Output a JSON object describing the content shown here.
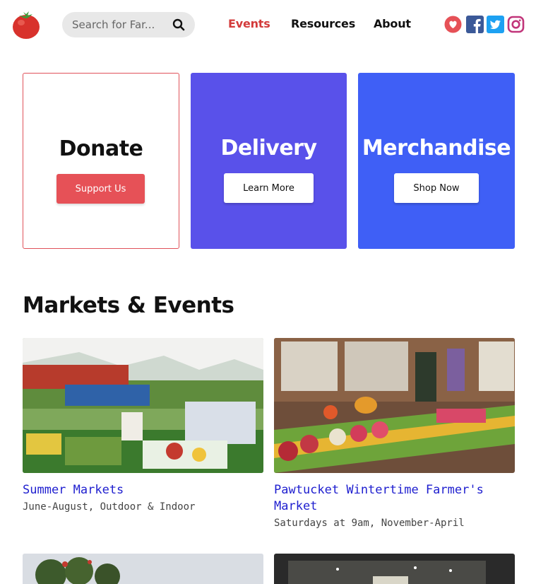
{
  "header": {
    "logo": "tomato-logo-icon",
    "search": {
      "placeholder": "Search for Far...",
      "value": ""
    },
    "nav": [
      {
        "label": "Events",
        "active": true
      },
      {
        "label": "Resources",
        "active": false
      },
      {
        "label": "About",
        "active": false
      }
    ],
    "social": [
      {
        "icon": "heart-icon",
        "color": "#e65157"
      },
      {
        "icon": "facebook-icon",
        "color": "#3b5998"
      },
      {
        "icon": "twitter-icon",
        "color": "#1da1f2"
      },
      {
        "icon": "instagram-icon",
        "color": "#c1357a"
      }
    ]
  },
  "cards": [
    {
      "title": "Donate",
      "button": "Support Us",
      "background": "#ffffff"
    },
    {
      "title": "Delivery",
      "button": "Learn More",
      "background": "#5951ea"
    },
    {
      "title": "Merchandise",
      "button": "Shop Now",
      "background": "#3f5ff6"
    }
  ],
  "events_section": {
    "title": "Markets & Events",
    "items": [
      {
        "title": "Summer Markets",
        "subtitle": "June-August, Outdoor & Indoor"
      },
      {
        "title": "Pawtucket Wintertime Farmer's Market",
        "subtitle": "Saturdays at 9am, November-April"
      }
    ]
  },
  "colors": {
    "accent": "#d33b3b",
    "link": "#1e1ecf"
  }
}
